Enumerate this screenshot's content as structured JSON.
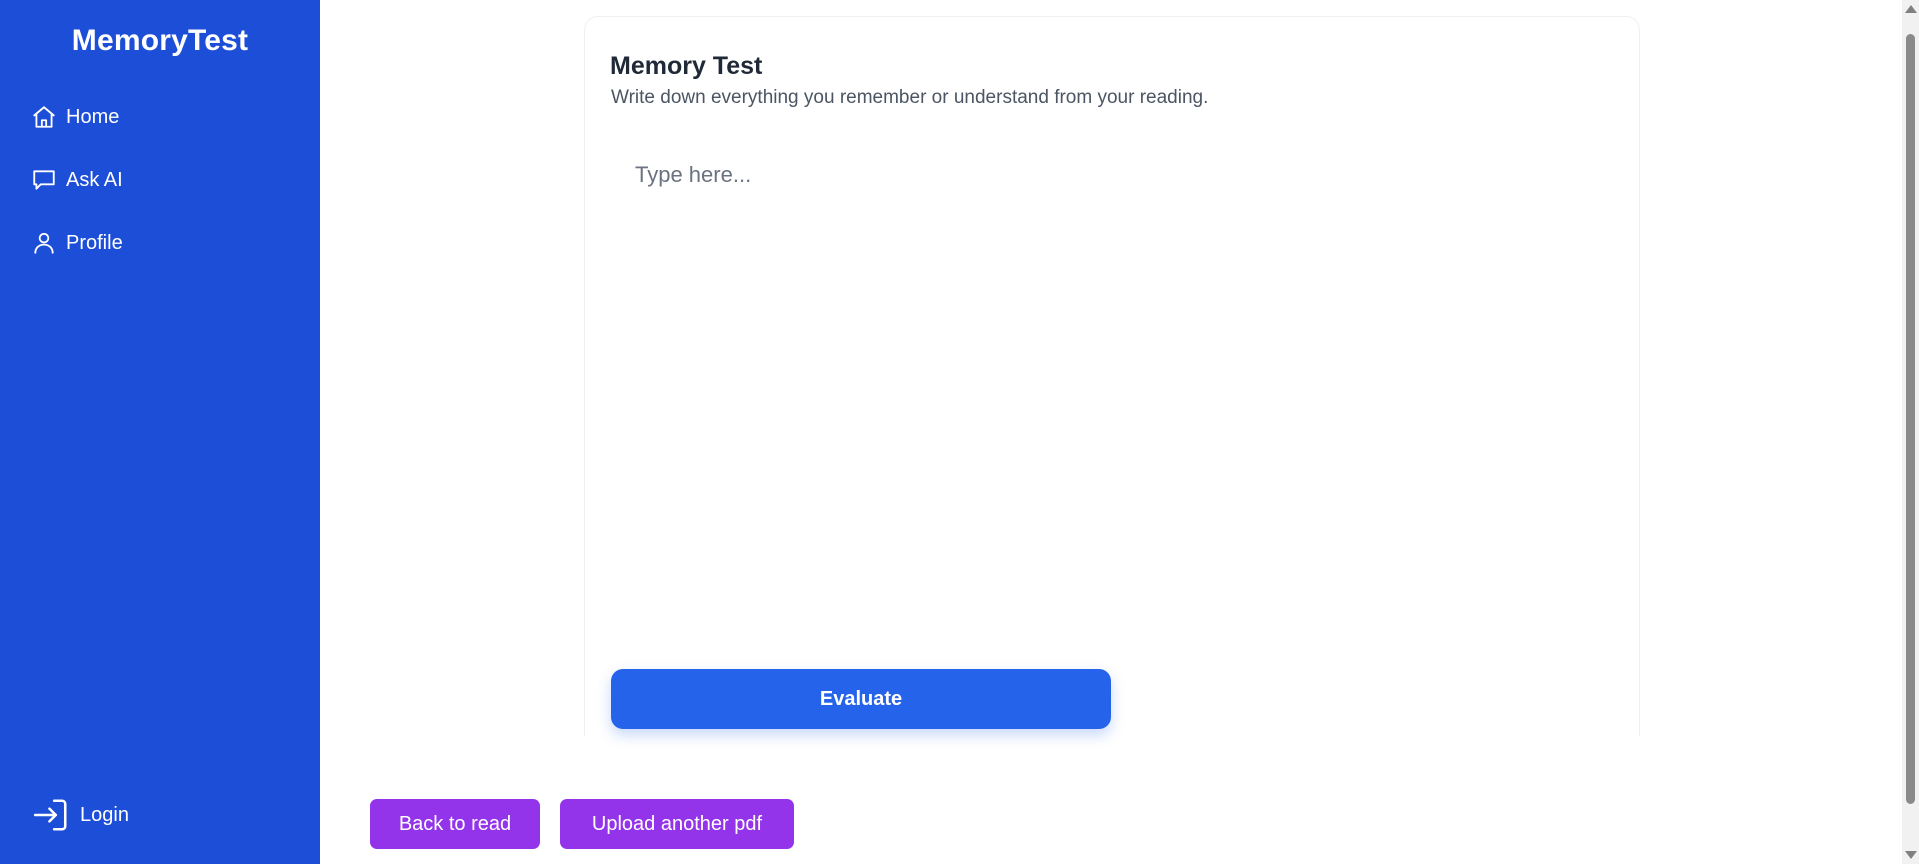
{
  "sidebar": {
    "brand": "MemoryTest",
    "items": [
      {
        "label": "Home",
        "icon": "home-icon"
      },
      {
        "label": "Ask AI",
        "icon": "chat-icon"
      },
      {
        "label": "Profile",
        "icon": "user-icon"
      }
    ],
    "login": {
      "label": "Login",
      "icon": "login-icon"
    }
  },
  "main": {
    "title": "Memory Test",
    "subtitle": "Write down everything you remember or understand from your reading.",
    "input": {
      "placeholder": "Type here...",
      "value": ""
    },
    "evaluate_label": "Evaluate"
  },
  "footer": {
    "back_label": "Back to read",
    "upload_label": "Upload another pdf"
  },
  "colors": {
    "sidebar": "#1d4ed8",
    "primary_button": "#2563eb",
    "secondary_button": "#9333ea",
    "text": "#1f2937",
    "subtitle": "#4b5563"
  }
}
